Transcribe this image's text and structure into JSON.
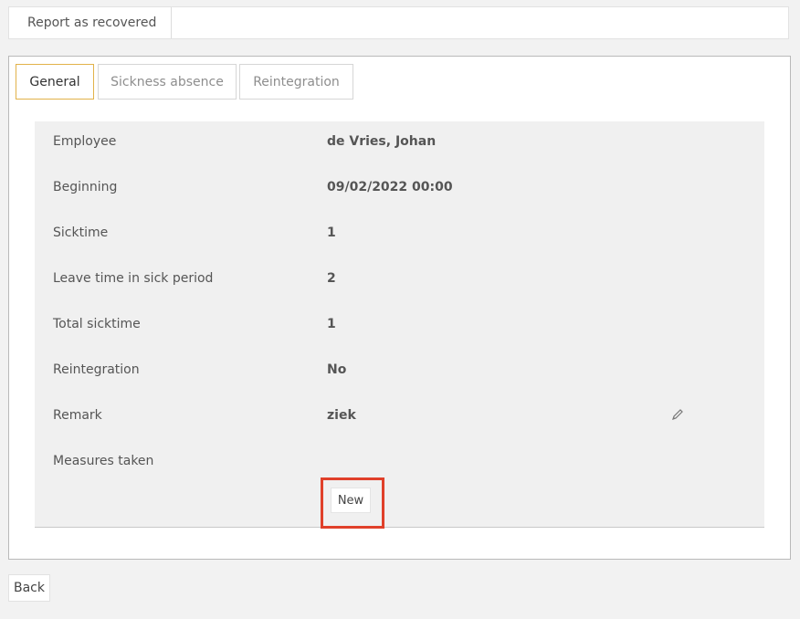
{
  "toolbar": {
    "report_recovered_label": "Report as recovered"
  },
  "tabs": [
    {
      "label": "General",
      "active": true
    },
    {
      "label": "Sickness absence",
      "active": false
    },
    {
      "label": "Reintegration",
      "active": false
    }
  ],
  "details": {
    "rows": [
      {
        "label": "Employee",
        "value": "de Vries, Johan"
      },
      {
        "label": "Beginning",
        "value": "09/02/2022 00:00"
      },
      {
        "label": "Sicktime",
        "value": "1"
      },
      {
        "label": "Leave time in sick period",
        "value": "2"
      },
      {
        "label": "Total sicktime",
        "value": "1"
      },
      {
        "label": "Reintegration",
        "value": "No"
      },
      {
        "label": "Remark",
        "value": "ziek"
      },
      {
        "label": "Measures taken",
        "value": ""
      }
    ],
    "remark_edit_icon": "pencil-icon",
    "new_button_label": "New"
  },
  "footer": {
    "back_label": "Back"
  },
  "colors": {
    "active_tab_border": "#e2b24a",
    "highlight": "#e0402a",
    "details_background": "#f0f0f0"
  }
}
